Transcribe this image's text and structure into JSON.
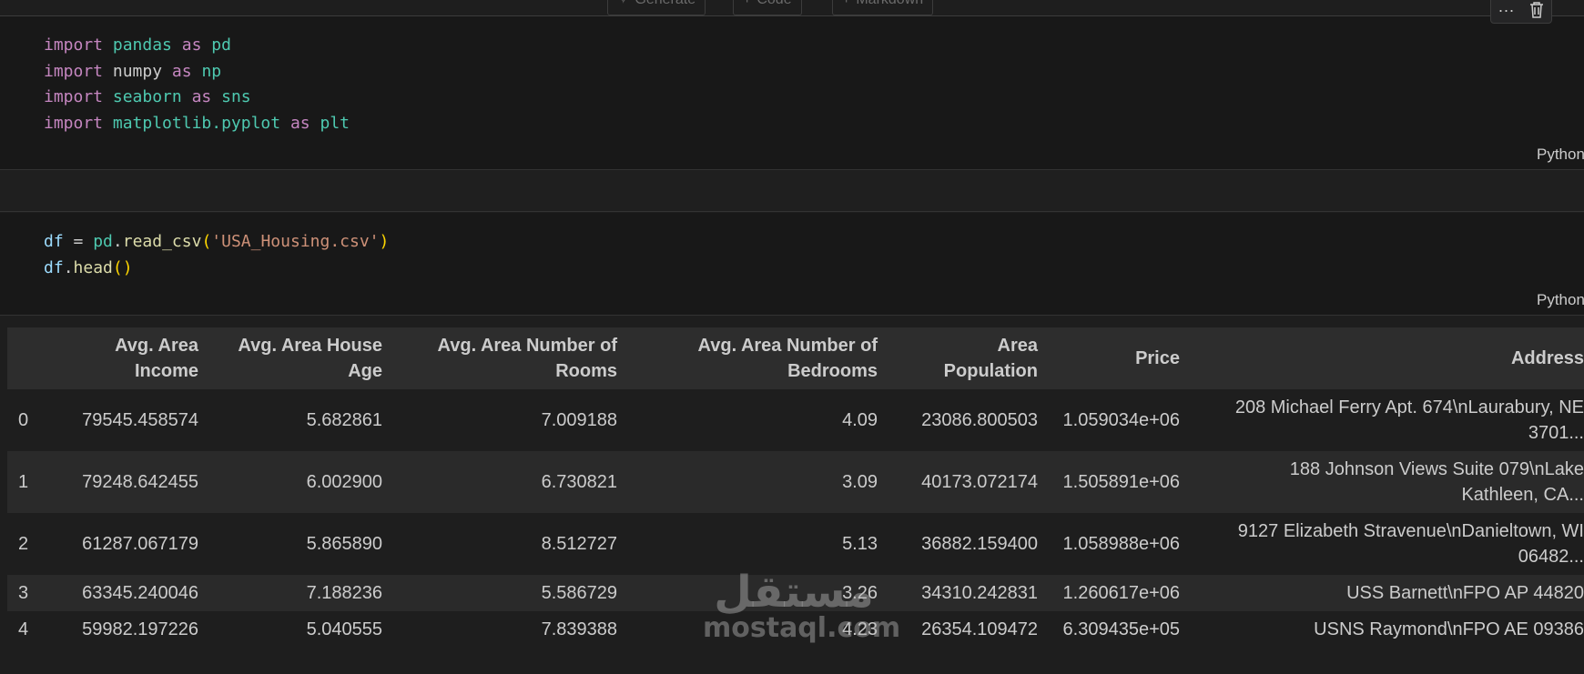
{
  "insert_bar": {
    "generate_label": "Generate",
    "code_label": "Code",
    "markdown_label": "Markdown"
  },
  "cell_toolbar": {
    "more_label": "···",
    "delete_icon": "trash-icon"
  },
  "cell1": {
    "lines": [
      {
        "kw1": "import",
        "mod": "pandas",
        "kw2": "as",
        "alias": "pd"
      },
      {
        "kw1": "import",
        "mod": "numpy",
        "kw2": "as",
        "alias": "np"
      },
      {
        "kw1": "import",
        "mod": "seaborn",
        "kw2": "as",
        "alias": "sns"
      },
      {
        "kw1": "import",
        "mod": "matplotlib.pyplot",
        "kw2": "as",
        "alias": "plt"
      }
    ],
    "language": "Python"
  },
  "cell2": {
    "line1": {
      "var": "df",
      "op": " = ",
      "mod": "pd",
      "dot": ".",
      "fn": "read_csv",
      "open": "(",
      "str": "'USA_Housing.csv'",
      "close": ")"
    },
    "line2": {
      "var": "df",
      "dot": ".",
      "fn": "head",
      "parens": "()"
    },
    "language": "Python"
  },
  "table": {
    "columns": [
      {
        "l1": "",
        "l2": ""
      },
      {
        "l1": "Avg. Area",
        "l2": "Income"
      },
      {
        "l1": "Avg. Area House",
        "l2": "Age"
      },
      {
        "l1": "Avg. Area Number of",
        "l2": "Rooms"
      },
      {
        "l1": "Avg. Area Number of",
        "l2": "Bedrooms"
      },
      {
        "l1": "Area",
        "l2": "Population"
      },
      {
        "l1": "",
        "l2": "Price"
      },
      {
        "l1": "",
        "l2": "Address"
      }
    ],
    "rows": [
      {
        "idx": "0",
        "income": "79545.458574",
        "age": "5.682861",
        "rooms": "7.009188",
        "bedrooms": "4.09",
        "pop": "23086.800503",
        "price": "1.059034e+06",
        "addr1": "208 Michael Ferry Apt. 674\\nLaurabury, NE",
        "addr2": "3701..."
      },
      {
        "idx": "1",
        "income": "79248.642455",
        "age": "6.002900",
        "rooms": "6.730821",
        "bedrooms": "3.09",
        "pop": "40173.072174",
        "price": "1.505891e+06",
        "addr1": "188 Johnson Views Suite 079\\nLake",
        "addr2": "Kathleen, CA..."
      },
      {
        "idx": "2",
        "income": "61287.067179",
        "age": "5.865890",
        "rooms": "8.512727",
        "bedrooms": "5.13",
        "pop": "36882.159400",
        "price": "1.058988e+06",
        "addr1": "9127 Elizabeth Stravenue\\nDanieltown, WI",
        "addr2": "06482..."
      },
      {
        "idx": "3",
        "income": "63345.240046",
        "age": "7.188236",
        "rooms": "5.586729",
        "bedrooms": "3.26",
        "pop": "34310.242831",
        "price": "1.260617e+06",
        "addr1": "USS Barnett\\nFPO AP 44820",
        "addr2": ""
      },
      {
        "idx": "4",
        "income": "59982.197226",
        "age": "5.040555",
        "rooms": "7.839388",
        "bedrooms": "4.23",
        "pop": "26354.109472",
        "price": "6.309435e+05",
        "addr1": "USNS Raymond\\nFPO AE 09386",
        "addr2": ""
      }
    ]
  },
  "watermark": {
    "arabic": "مستقل",
    "latin": "mostaql.com"
  }
}
